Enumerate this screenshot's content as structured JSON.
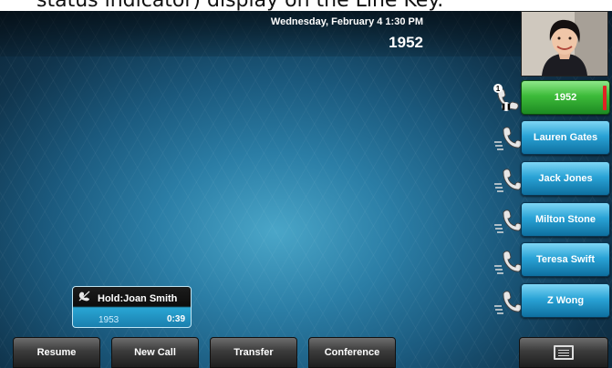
{
  "caption": {
    "text": "status indicator) display on the Line Key."
  },
  "status_bar": {
    "datetime": "Wednesday, February 4  1:30 PM",
    "extension": "1952"
  },
  "line_keys": [
    {
      "label": "1952",
      "state": "active",
      "badge": "1"
    },
    {
      "label": "Lauren Gates",
      "state": "idle"
    },
    {
      "label": "Jack Jones",
      "state": "idle"
    },
    {
      "label": "Milton Stone",
      "state": "idle"
    },
    {
      "label": "Teresa Swift",
      "state": "idle"
    },
    {
      "label": "Z Wong",
      "state": "idle"
    }
  ],
  "held_call": {
    "title": "Hold:Joan Smith",
    "number": "1953",
    "duration": "0:39"
  },
  "softkeys": [
    "Resume",
    "New Call",
    "Transfer",
    "Conference"
  ],
  "colors": {
    "active_line": "#3dbb3a",
    "line_key": "#2aa3d6",
    "indicator": "#e12323"
  }
}
